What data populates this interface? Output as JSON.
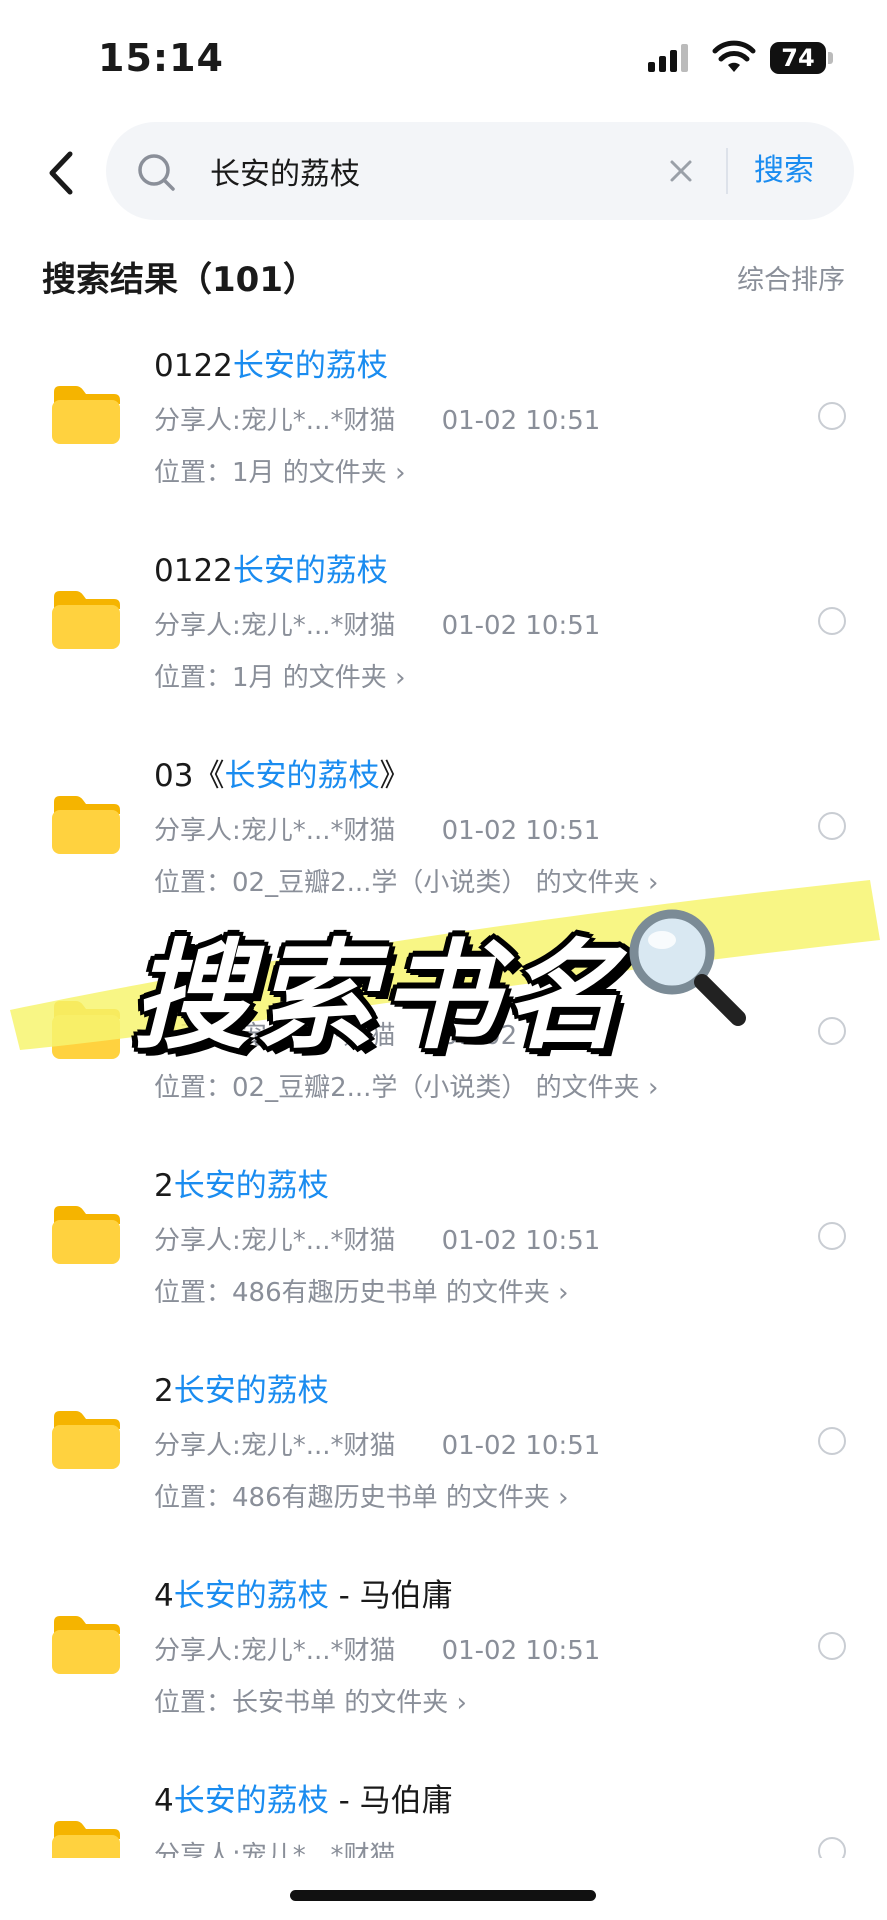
{
  "status_bar": {
    "time": "15:14",
    "battery": "74"
  },
  "search": {
    "query": "长安的荔枝",
    "button_label": "搜索"
  },
  "results": {
    "title": "搜索结果（101）",
    "sort_label": "综合排序",
    "items": [
      {
        "title_prefix": "0122",
        "title_highlight": "长安的荔枝",
        "title_suffix": "",
        "sharer": "分享人:宠儿*...*财猫",
        "date": "01-02 10:51",
        "location": "位置：1月 的文件夹 ›"
      },
      {
        "title_prefix": "0122",
        "title_highlight": "长安的荔枝",
        "title_suffix": "",
        "sharer": "分享人:宠儿*...*财猫",
        "date": "01-02 10:51",
        "location": "位置：1月 的文件夹 ›"
      },
      {
        "title_prefix": "03《",
        "title_highlight": "长安的荔枝",
        "title_suffix": "》",
        "sharer": "分享人:宠儿*...*财猫",
        "date": "01-02 10:51",
        "location": "位置：02_豆瓣2...学（小说类） 的文件夹 ›"
      },
      {
        "title_prefix": "",
        "title_highlight": "",
        "title_suffix": "",
        "sharer": "分享人:宠儿*...*财猫",
        "date": "01-02 10:51",
        "location": "位置：02_豆瓣2...学（小说类） 的文件夹 ›"
      },
      {
        "title_prefix": "2",
        "title_highlight": "长安的荔枝",
        "title_suffix": "",
        "sharer": "分享人:宠儿*...*财猫",
        "date": "01-02 10:51",
        "location": "位置：486有趣历史书单 的文件夹 ›"
      },
      {
        "title_prefix": "2",
        "title_highlight": "长安的荔枝",
        "title_suffix": "",
        "sharer": "分享人:宠儿*...*财猫",
        "date": "01-02 10:51",
        "location": "位置：486有趣历史书单 的文件夹 ›"
      },
      {
        "title_prefix": "4",
        "title_highlight": "长安的荔枝",
        "title_suffix": " - 马伯庸",
        "sharer": "分享人:宠儿*...*财猫",
        "date": "01-02 10:51",
        "location": "位置：长安书单 的文件夹 ›"
      },
      {
        "title_prefix": "4",
        "title_highlight": "长安的荔枝",
        "title_suffix": " - 马伯庸",
        "sharer": "分享人:宠儿*...*财猫",
        "date": "",
        "location": ""
      }
    ]
  },
  "overlay": {
    "text": "搜索书名",
    "highlight_color": "#f7f570"
  },
  "colors": {
    "accent": "#1a8cf0",
    "folder": "#ffcc33",
    "muted": "#8a8f99"
  }
}
